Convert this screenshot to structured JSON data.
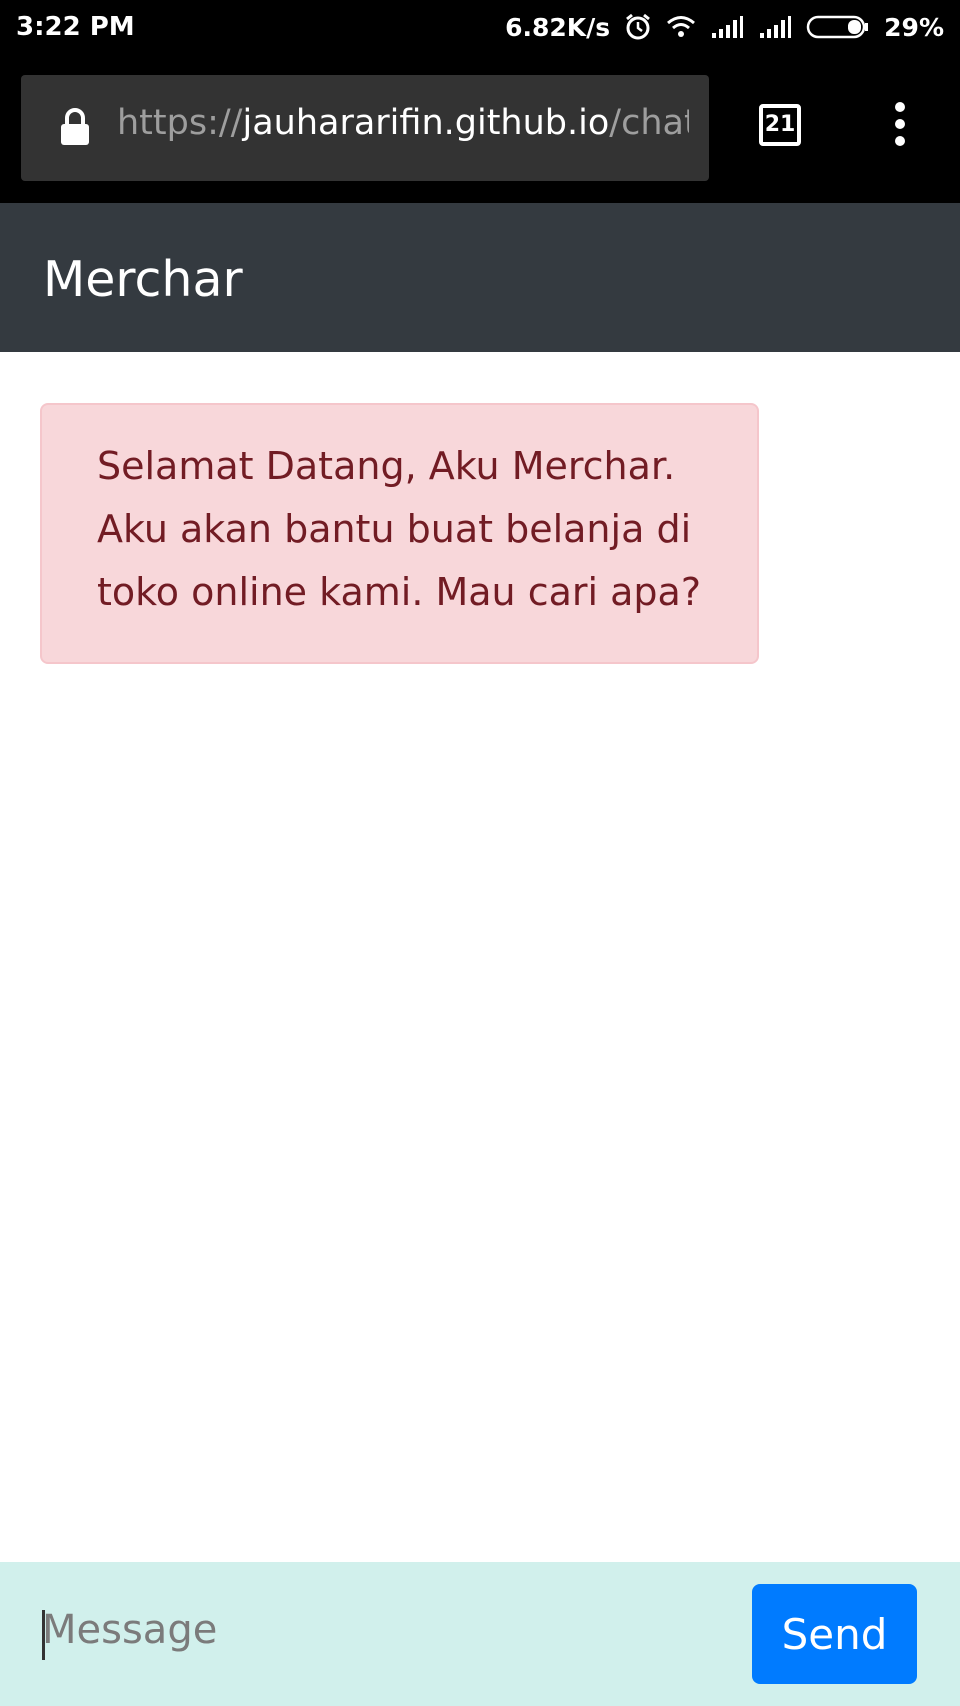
{
  "statusbar": {
    "time": "3:22 PM",
    "network_speed": "6.82K/s",
    "battery": "29%",
    "icons": [
      "alarm-icon",
      "wifi-icon",
      "signal-icon",
      "signal-icon",
      "battery-icon"
    ]
  },
  "browser": {
    "url_scheme": "https://",
    "url_host": "jauhararifin.github.io",
    "url_path": "/chatbc",
    "tab_count": "21"
  },
  "app": {
    "title": "Merchar",
    "header_color": "#343a40"
  },
  "chat": {
    "messages": [
      {
        "sender": "bot",
        "text": "Selamat Datang, Aku Merchar. Aku akan bantu buat belanja di toko online kami. Mau cari apa?",
        "bg_color": "#f8d7da",
        "text_color": "#721c24"
      }
    ]
  },
  "composer": {
    "placeholder": "Message",
    "value": "",
    "send_label": "Send",
    "send_color": "#007bff",
    "bg_color": "#d1f0ec"
  }
}
